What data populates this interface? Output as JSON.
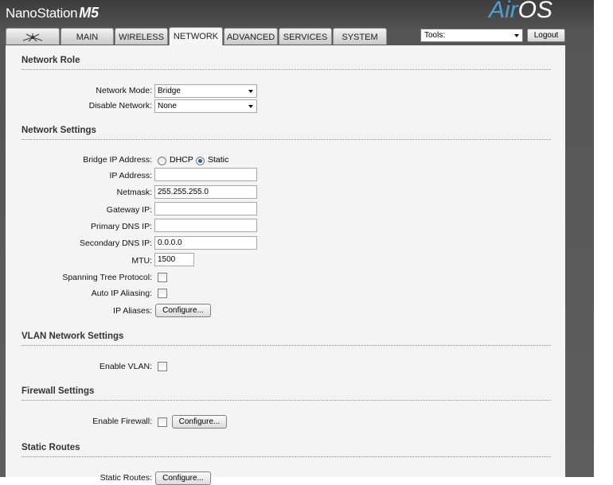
{
  "header": {
    "brand_name": "NanoStation",
    "brand_model": "M5",
    "logo_air": "Air",
    "logo_os": "OS"
  },
  "tabs": [
    {
      "label": "",
      "icon": "ubiquiti-logo-icon"
    },
    {
      "label": "MAIN"
    },
    {
      "label": "WIRELESS"
    },
    {
      "label": "NETWORK"
    },
    {
      "label": "ADVANCED"
    },
    {
      "label": "SERVICES"
    },
    {
      "label": "SYSTEM"
    }
  ],
  "active_tab": "NETWORK",
  "toolbar": {
    "tools_value": "Tools:",
    "logout_label": "Logout"
  },
  "network_role": {
    "title": "Network Role",
    "network_mode_label": "Network Mode:",
    "network_mode_value": "Bridge",
    "disable_network_label": "Disable Network:",
    "disable_network_value": "None"
  },
  "network_settings": {
    "title": "Network Settings",
    "bridge_ip_label": "Bridge IP Address:",
    "dhcp_label": "DHCP",
    "static_label": "Static",
    "selected_mode": "Static",
    "ip_label": "IP Address:",
    "ip_value": "",
    "netmask_label": "Netmask:",
    "netmask_value": "255.255.255.0",
    "gateway_label": "Gateway IP:",
    "gateway_value": "",
    "primary_dns_label": "Primary DNS IP:",
    "primary_dns_value": "",
    "secondary_dns_label": "Secondary DNS IP:",
    "secondary_dns_value": "0.0.0.0",
    "mtu_label": "MTU:",
    "mtu_value": "1500",
    "stp_label": "Spanning Tree Protocol:",
    "stp_checked": false,
    "auto_alias_label": "Auto IP Aliasing:",
    "auto_alias_checked": false,
    "ip_aliases_label": "IP Aliases:",
    "configure_label": "Configure..."
  },
  "vlan": {
    "title": "VLAN Network Settings",
    "enable_label": "Enable VLAN:",
    "enabled": false
  },
  "firewall": {
    "title": "Firewall Settings",
    "enable_label": "Enable Firewall:",
    "enabled": false,
    "configure_label": "Configure..."
  },
  "static_routes": {
    "title": "Static Routes",
    "label": "Static Routes:",
    "configure_label": "Configure..."
  },
  "colors": {
    "chrome_dark": "#4a4a4a",
    "panel_bg": "#f4f4f4",
    "airos_blue": "#4a9fd6"
  }
}
